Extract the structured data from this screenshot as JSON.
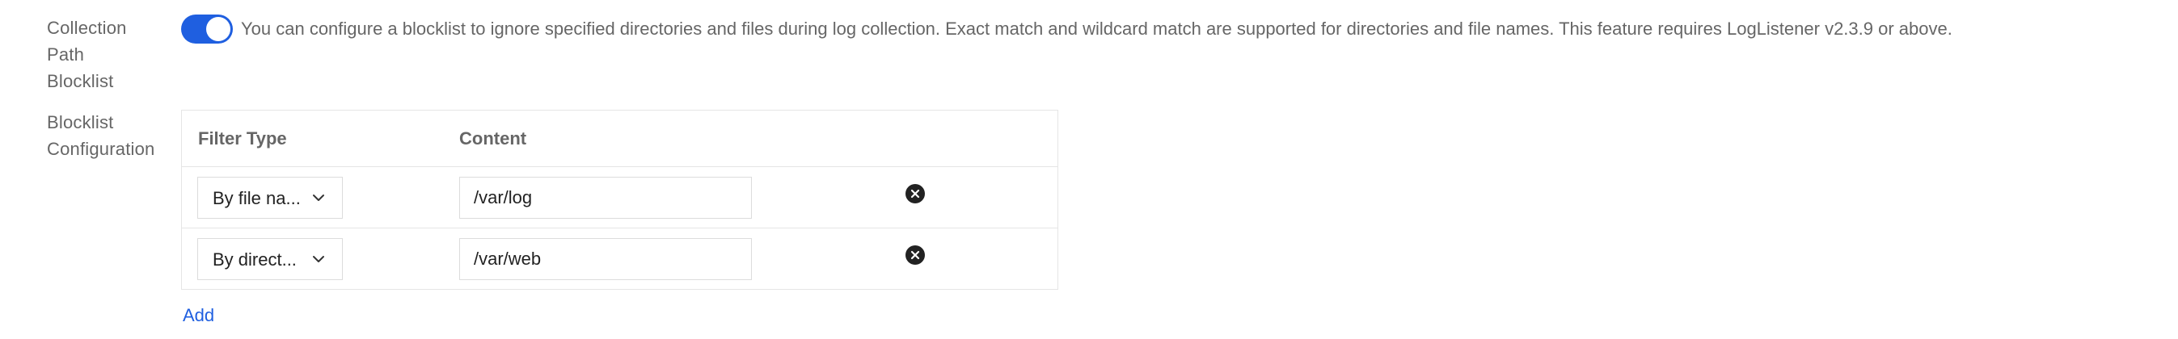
{
  "collection_path_blocklist": {
    "label_lines": [
      "Collection",
      "Path",
      "Blocklist"
    ],
    "enabled": true,
    "description": "You can configure a blocklist to ignore specified directories and files during log collection. Exact match and wildcard match are supported for directories and file names. This feature requires LogListener v2.3.9 or above."
  },
  "blocklist_configuration": {
    "label_lines": [
      "Blocklist",
      "Configuration"
    ],
    "columns": {
      "filter_type": "Filter Type",
      "content": "Content"
    },
    "rows": [
      {
        "filter_type": "By file na...",
        "content": "/var/log"
      },
      {
        "filter_type": "By direct...",
        "content": "/var/web"
      }
    ],
    "add_label": "Add"
  },
  "icons": {
    "toggle": "toggle-switch-on",
    "select_chevron": "chevron-down-icon",
    "remove": "close-circle-icon"
  },
  "colors": {
    "accent": "#1f5fe0",
    "label_text": "#666666",
    "border": "#e5e5e5"
  }
}
